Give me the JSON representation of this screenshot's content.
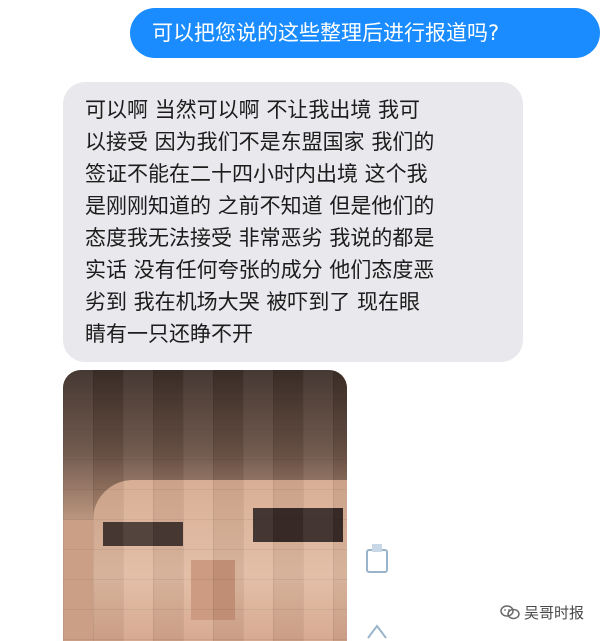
{
  "chat": {
    "outgoing": "可以把您说的这些整理后进行报道吗?",
    "incoming_lines": [
      "可以啊 当然可以啊 不让我出境 我可",
      "以接受 因为我们不是东盟国家 我们的",
      "签证不能在二十四小时内出境 这个我",
      "是刚刚知道的 之前不知道 但是他们的",
      "态度我无法接受 非常恶劣 我说的都是",
      "实话 没有任何夸张的成分 他们态度恶",
      "劣到 我在机场大哭 被吓到了 现在眼",
      "睛有一只还睁不开"
    ],
    "outgoing_color": "#1a8cff",
    "incoming_color": "#e9e9ed"
  },
  "photo": {
    "description_icon": "pixelated-photo"
  },
  "watermark": {
    "text": "吴哥时报",
    "icon": "wechat-channel-icon"
  }
}
